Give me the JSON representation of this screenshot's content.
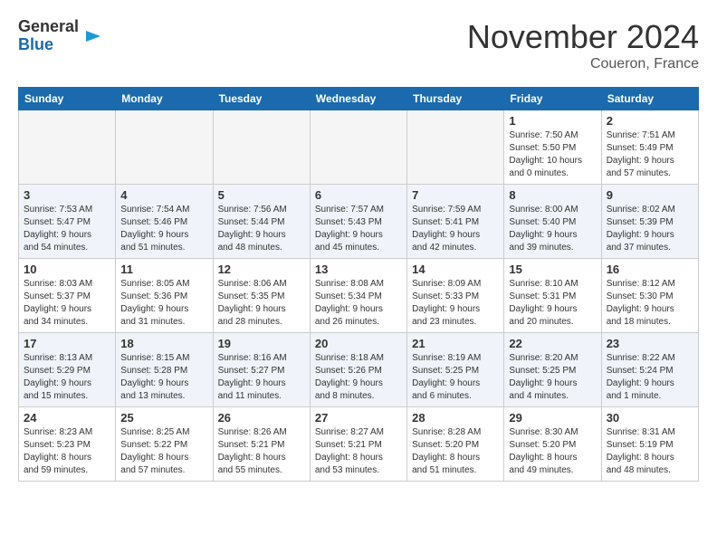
{
  "header": {
    "logo_line1": "General",
    "logo_line2": "Blue",
    "month": "November 2024",
    "location": "Coueron, France"
  },
  "weekdays": [
    "Sunday",
    "Monday",
    "Tuesday",
    "Wednesday",
    "Thursday",
    "Friday",
    "Saturday"
  ],
  "weeks": [
    [
      {
        "day": "",
        "text": ""
      },
      {
        "day": "",
        "text": ""
      },
      {
        "day": "",
        "text": ""
      },
      {
        "day": "",
        "text": ""
      },
      {
        "day": "",
        "text": ""
      },
      {
        "day": "1",
        "text": "Sunrise: 7:50 AM\nSunset: 5:50 PM\nDaylight: 10 hours\nand 0 minutes."
      },
      {
        "day": "2",
        "text": "Sunrise: 7:51 AM\nSunset: 5:49 PM\nDaylight: 9 hours\nand 57 minutes."
      }
    ],
    [
      {
        "day": "3",
        "text": "Sunrise: 7:53 AM\nSunset: 5:47 PM\nDaylight: 9 hours\nand 54 minutes."
      },
      {
        "day": "4",
        "text": "Sunrise: 7:54 AM\nSunset: 5:46 PM\nDaylight: 9 hours\nand 51 minutes."
      },
      {
        "day": "5",
        "text": "Sunrise: 7:56 AM\nSunset: 5:44 PM\nDaylight: 9 hours\nand 48 minutes."
      },
      {
        "day": "6",
        "text": "Sunrise: 7:57 AM\nSunset: 5:43 PM\nDaylight: 9 hours\nand 45 minutes."
      },
      {
        "day": "7",
        "text": "Sunrise: 7:59 AM\nSunset: 5:41 PM\nDaylight: 9 hours\nand 42 minutes."
      },
      {
        "day": "8",
        "text": "Sunrise: 8:00 AM\nSunset: 5:40 PM\nDaylight: 9 hours\nand 39 minutes."
      },
      {
        "day": "9",
        "text": "Sunrise: 8:02 AM\nSunset: 5:39 PM\nDaylight: 9 hours\nand 37 minutes."
      }
    ],
    [
      {
        "day": "10",
        "text": "Sunrise: 8:03 AM\nSunset: 5:37 PM\nDaylight: 9 hours\nand 34 minutes."
      },
      {
        "day": "11",
        "text": "Sunrise: 8:05 AM\nSunset: 5:36 PM\nDaylight: 9 hours\nand 31 minutes."
      },
      {
        "day": "12",
        "text": "Sunrise: 8:06 AM\nSunset: 5:35 PM\nDaylight: 9 hours\nand 28 minutes."
      },
      {
        "day": "13",
        "text": "Sunrise: 8:08 AM\nSunset: 5:34 PM\nDaylight: 9 hours\nand 26 minutes."
      },
      {
        "day": "14",
        "text": "Sunrise: 8:09 AM\nSunset: 5:33 PM\nDaylight: 9 hours\nand 23 minutes."
      },
      {
        "day": "15",
        "text": "Sunrise: 8:10 AM\nSunset: 5:31 PM\nDaylight: 9 hours\nand 20 minutes."
      },
      {
        "day": "16",
        "text": "Sunrise: 8:12 AM\nSunset: 5:30 PM\nDaylight: 9 hours\nand 18 minutes."
      }
    ],
    [
      {
        "day": "17",
        "text": "Sunrise: 8:13 AM\nSunset: 5:29 PM\nDaylight: 9 hours\nand 15 minutes."
      },
      {
        "day": "18",
        "text": "Sunrise: 8:15 AM\nSunset: 5:28 PM\nDaylight: 9 hours\nand 13 minutes."
      },
      {
        "day": "19",
        "text": "Sunrise: 8:16 AM\nSunset: 5:27 PM\nDaylight: 9 hours\nand 11 minutes."
      },
      {
        "day": "20",
        "text": "Sunrise: 8:18 AM\nSunset: 5:26 PM\nDaylight: 9 hours\nand 8 minutes."
      },
      {
        "day": "21",
        "text": "Sunrise: 8:19 AM\nSunset: 5:25 PM\nDaylight: 9 hours\nand 6 minutes."
      },
      {
        "day": "22",
        "text": "Sunrise: 8:20 AM\nSunset: 5:25 PM\nDaylight: 9 hours\nand 4 minutes."
      },
      {
        "day": "23",
        "text": "Sunrise: 8:22 AM\nSunset: 5:24 PM\nDaylight: 9 hours\nand 1 minute."
      }
    ],
    [
      {
        "day": "24",
        "text": "Sunrise: 8:23 AM\nSunset: 5:23 PM\nDaylight: 8 hours\nand 59 minutes."
      },
      {
        "day": "25",
        "text": "Sunrise: 8:25 AM\nSunset: 5:22 PM\nDaylight: 8 hours\nand 57 minutes."
      },
      {
        "day": "26",
        "text": "Sunrise: 8:26 AM\nSunset: 5:21 PM\nDaylight: 8 hours\nand 55 minutes."
      },
      {
        "day": "27",
        "text": "Sunrise: 8:27 AM\nSunset: 5:21 PM\nDaylight: 8 hours\nand 53 minutes."
      },
      {
        "day": "28",
        "text": "Sunrise: 8:28 AM\nSunset: 5:20 PM\nDaylight: 8 hours\nand 51 minutes."
      },
      {
        "day": "29",
        "text": "Sunrise: 8:30 AM\nSunset: 5:20 PM\nDaylight: 8 hours\nand 49 minutes."
      },
      {
        "day": "30",
        "text": "Sunrise: 8:31 AM\nSunset: 5:19 PM\nDaylight: 8 hours\nand 48 minutes."
      }
    ]
  ]
}
